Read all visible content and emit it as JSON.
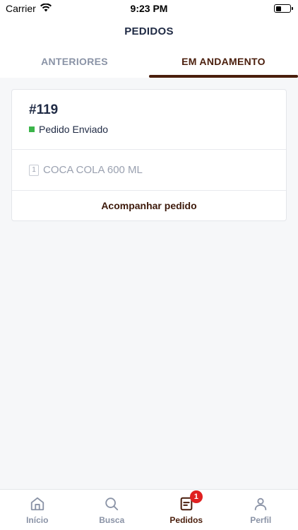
{
  "status_bar": {
    "carrier": "Carrier",
    "time": "9:23 PM",
    "battery_level": 0.4
  },
  "header": {
    "title": "PEDIDOS"
  },
  "tabs": [
    {
      "label": "ANTERIORES",
      "active": false
    },
    {
      "label": "EM ANDAMENTO",
      "active": true
    }
  ],
  "order": {
    "number": "#119",
    "status": "Pedido Enviado",
    "status_color": "#3bb54a",
    "items": [
      {
        "quantity": "1",
        "name": "COCA COLA 600 ML"
      }
    ],
    "action_label": "Acompanhar pedido"
  },
  "bottom_nav": [
    {
      "label": "Início",
      "icon": "home-icon",
      "active": false
    },
    {
      "label": "Busca",
      "icon": "search-icon",
      "active": false
    },
    {
      "label": "Pedidos",
      "icon": "orders-icon",
      "active": true,
      "badge": "1"
    },
    {
      "label": "Perfil",
      "icon": "profile-icon",
      "active": false
    }
  ],
  "colors": {
    "accent": "#4a1e0c",
    "inactive": "#8a93a6",
    "badge": "#e02020"
  }
}
